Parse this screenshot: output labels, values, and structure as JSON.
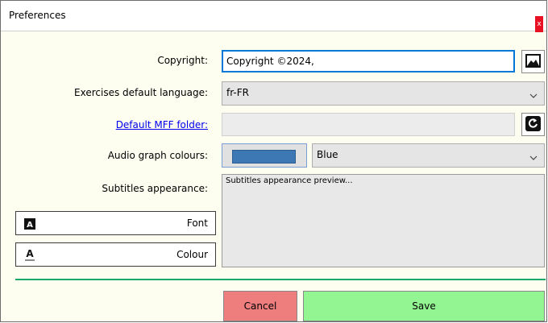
{
  "window": {
    "title": "Preferences",
    "close_label": "x"
  },
  "form": {
    "copyright_label": "Copyright:",
    "copyright_value": "Copyright ©2024,",
    "language_label": "Exercises default language:",
    "language_value": "fr-FR",
    "mff_folder_label": "Default MFF folder:",
    "mff_folder_value": "",
    "audio_colours_label": "Audio graph colours:",
    "audio_colour_value": "Blue",
    "audio_colour_hex": "#3d78b4",
    "subtitles_label": "Subtitles appearance:",
    "subtitles_preview": "Subtitles appearance preview..."
  },
  "buttons": {
    "font_label": "Font",
    "colour_label": "Colour",
    "cancel_label": "Cancel",
    "save_label": "Save"
  },
  "icons": {
    "copyright_image": "image-icon",
    "mff_reset": "reset-icon",
    "font": "font-icon",
    "colour": "text-colour-icon"
  },
  "colors": {
    "cancel": "#ee7e7e",
    "save": "#92f592",
    "divider": "#17a86a",
    "focus_border": "#0078d7"
  }
}
